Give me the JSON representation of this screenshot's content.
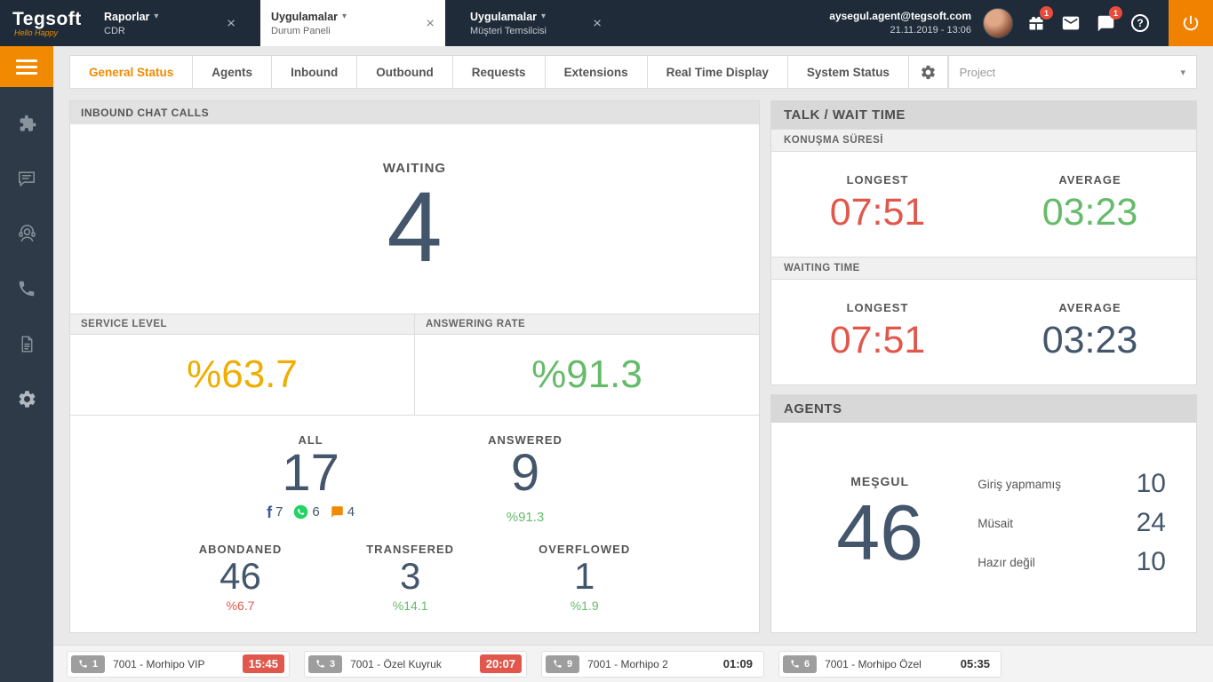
{
  "glyphs": {
    "chevron_down": "▾",
    "close": "×",
    "help": "?",
    "facebook_f": "f",
    "dropdown_caret": "▾"
  },
  "colors": {
    "accent_orange": "#f18a00",
    "navy": "#44566b",
    "red": "#e2574c",
    "green": "#66bb6a",
    "gold": "#f0ad00",
    "topbar_bg": "#1f2b38",
    "sidebar_bg": "#2e3a47"
  },
  "topbar": {
    "logo_text": "Tegsoft",
    "logo_tagline": "Hello Happy",
    "tabs": [
      {
        "title": "Raporlar",
        "subtitle": "CDR"
      },
      {
        "title": "Uygulamalar",
        "subtitle": "Durum Paneli"
      },
      {
        "title": "Uygulamalar",
        "subtitle": "Müşteri Temsilcisi"
      }
    ],
    "user_email": "aysegul.agent@tegsoft.com",
    "datetime": "21.11.2019 - 13:06",
    "gift_badge": "1",
    "chat_badge": "1"
  },
  "main_tabs": {
    "items": [
      {
        "label": "General Status"
      },
      {
        "label": "Agents"
      },
      {
        "label": "Inbound"
      },
      {
        "label": "Outbound"
      },
      {
        "label": "Requests"
      },
      {
        "label": "Extensions"
      },
      {
        "label": "Real Time Display"
      },
      {
        "label": "System Status"
      }
    ],
    "project_label": "Project"
  },
  "inbound_panel": {
    "title": "INBOUND CHAT CALLS",
    "waiting": {
      "label": "WAITING",
      "value": "4"
    },
    "service_level": {
      "label": "SERVICE LEVEL",
      "value": "%63.7"
    },
    "answering_rate": {
      "label": "ANSWERING RATE",
      "value": "%91.3"
    },
    "all": {
      "label": "ALL",
      "value": "17",
      "facebook": "7",
      "whatsapp": "6",
      "chat": "4"
    },
    "answered": {
      "label": "ANSWERED",
      "value": "9",
      "pct": "%91.3"
    },
    "abandoned": {
      "label": "ABONDANED",
      "value": "46",
      "pct": "%6.7"
    },
    "transferred": {
      "label": "TRANSFERED",
      "value": "3",
      "pct": "%14.1"
    },
    "overflowed": {
      "label": "OVERFLOWED",
      "value": "1",
      "pct": "%1.9"
    }
  },
  "talk_panel": {
    "title": "TALK / WAIT TIME",
    "talk_time": {
      "label": "KONUŞMA SÜRESİ",
      "longest_label": "LONGEST",
      "longest": "07:51",
      "average_label": "AVERAGE",
      "average": "03:23"
    },
    "wait_time": {
      "label": "WAITING TIME",
      "longest_label": "LONGEST",
      "longest": "07:51",
      "average_label": "AVERAGE",
      "average": "03:23"
    }
  },
  "agents_panel": {
    "title": "AGENTS",
    "busy": {
      "label": "MEŞGUL",
      "value": "46"
    },
    "states": [
      {
        "label": "Giriş yapmamış",
        "value": "10"
      },
      {
        "label": "Müsait",
        "value": "24"
      },
      {
        "label": "Hazır değil",
        "value": "10"
      }
    ]
  },
  "queue_bar": {
    "queues": [
      {
        "count": "1",
        "name": "7001 - Morhipo VIP",
        "time": "15:45"
      },
      {
        "count": "3",
        "name": "7001 - Özel Kuyruk",
        "time": "20:07"
      },
      {
        "count": "9",
        "name": "7001 - Morhipo 2",
        "time": "01:09"
      },
      {
        "count": "6",
        "name": "7001 - Morhipo Özel",
        "time": "05:35"
      }
    ]
  }
}
